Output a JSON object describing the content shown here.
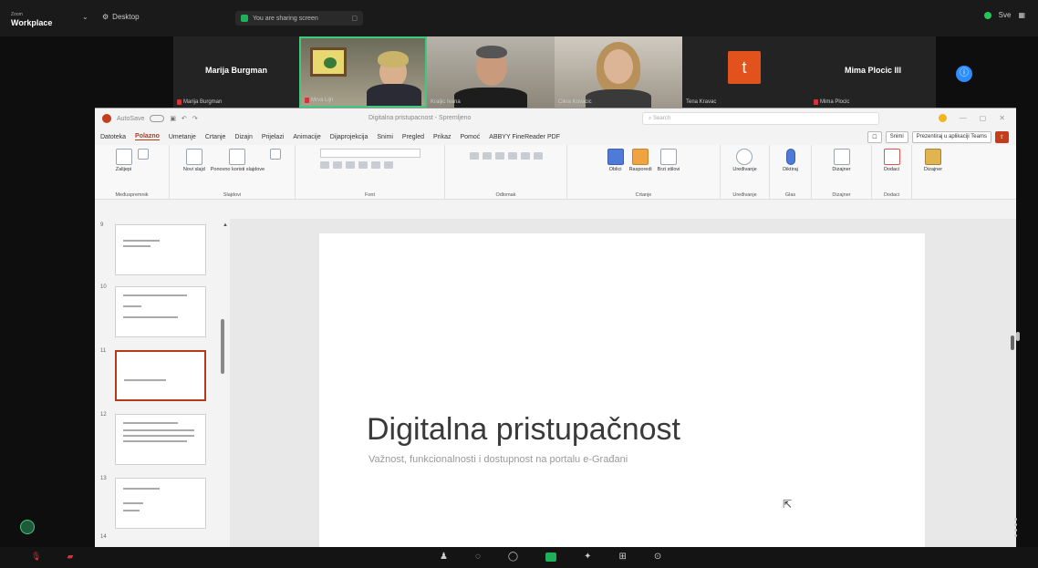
{
  "zoom": {
    "app_name": "Zoom",
    "app_sub": "Workplace",
    "view_label": "Desktop",
    "share_label": "You are sharing screen",
    "right_label": "Sve"
  },
  "participants": [
    {
      "name": "Marija Burgman",
      "display": "Marija Burgman",
      "muted": true
    },
    {
      "name": "Mrva Lijn",
      "display": "",
      "muted": true
    },
    {
      "name": "Kraljic Ivana",
      "display": "",
      "muted": false
    },
    {
      "name": "Cikra Kovacic",
      "display": "",
      "muted": false
    },
    {
      "name": "Tena Kravac",
      "display": "t",
      "muted": false
    },
    {
      "name": "Mima Plocic",
      "display": "Mima Plocic III",
      "muted": true
    }
  ],
  "ppt": {
    "autosave": "AutoSave",
    "title": "Digitalna pristupacnost - Spremljeno",
    "search_placeholder": "Search",
    "tabs": [
      "Datoteka",
      "Polazno",
      "Umetanje",
      "Crtanje",
      "Dizajn",
      "Prijelazi",
      "Animacije",
      "Dijaprojekcija",
      "Snimi",
      "Pregled",
      "Prikaz",
      "Pomoć",
      "ABBYY FineReader PDF"
    ],
    "active_tab": 1,
    "tabs_right": [
      "Snimi",
      "Prezentiraj u aplikaciji Teams"
    ],
    "groups": [
      {
        "label": "Međuspremnik",
        "cmds": [
          "Zalijepi"
        ]
      },
      {
        "label": "Slajdovi",
        "cmds": [
          "Novi slajd",
          "Ponovno koristi slajdove"
        ]
      },
      {
        "label": "Font",
        "cmds": []
      },
      {
        "label": "Odlomak",
        "cmds": []
      },
      {
        "label": "Crtanje",
        "cmds": [
          "Oblici",
          "Rasporedi",
          "Brzi stilovi"
        ]
      },
      {
        "label": "Uređivanje",
        "cmds": [
          "Uređivanje"
        ]
      },
      {
        "label": "Glas",
        "cmds": [
          "Diktiraj"
        ]
      },
      {
        "label": "Dizajner",
        "cmds": [
          "Dizajner"
        ]
      },
      {
        "label": "Dodaci",
        "cmds": [
          "Dodaci"
        ]
      },
      {
        "label": "",
        "cmds": [
          "Dizajner"
        ]
      }
    ],
    "slides": [
      "9",
      "10",
      "11",
      "12",
      "13",
      "14"
    ],
    "selected_slide": "11",
    "slide_title": "Digitalna pristupačnost",
    "slide_subtitle": "Važnost, funkcionalnosti i dostupnost na portalu e-Građani"
  },
  "colors": {
    "accent": "#b53a1c",
    "speaker": "#3fc97b",
    "mute": "#d8333a",
    "zoom_blue": "#2d8cff"
  }
}
